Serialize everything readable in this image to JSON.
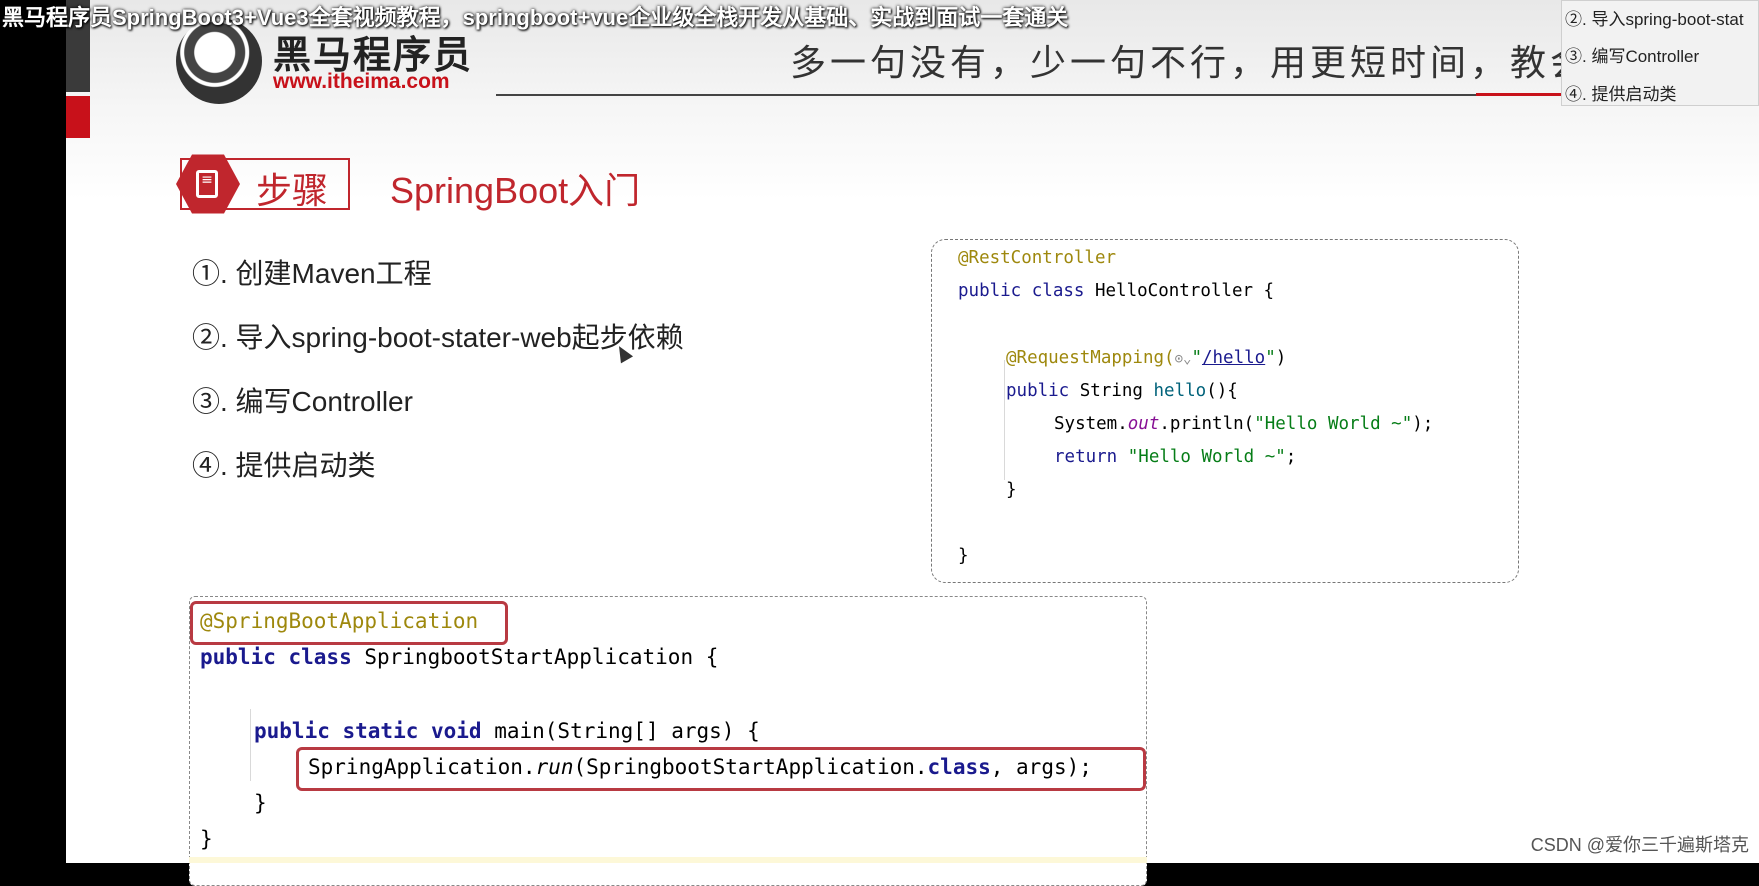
{
  "video": {
    "title": "黑马程序员SpringBoot3+Vue3全套视频教程，springboot+vue企业级全栈开发从基础、实战到面试一套通关"
  },
  "header": {
    "brand": "黑马程序员",
    "url": "www.itheima.com",
    "slogan": "多一句没有，少一句不行，用更短时间，教会更实"
  },
  "section": {
    "badge": "步骤",
    "title": "SpringBoot入门"
  },
  "steps": [
    "①. 创建Maven工程",
    "②. 导入spring-boot-stater-web起步依赖",
    "③. 编写Controller",
    "④. 提供启动类"
  ],
  "popup": {
    "items": [
      "②. 导入spring-boot-stat",
      "③. 编写Controller",
      "④. 提供启动类"
    ]
  },
  "controller_code": {
    "l1": "@RestController",
    "l2_kw": "public class",
    "l2_rest": " HelloController {",
    "l3_ann": "@RequestMapping(",
    "l3_icon": "⊙⌄",
    "l3_q1": "\"",
    "l3_link": "/hello",
    "l3_q2": "\"",
    "l3_close": ")",
    "l4_kw": "public",
    "l4_type": " String ",
    "l4_mtd": "hello",
    "l4_rest": "(){",
    "l5_a": "System.",
    "l5_field": "out",
    "l5_b": ".println(",
    "l5_str": "\"Hello World ~\"",
    "l5_c": ");",
    "l6_kw": "return",
    "l6_str": " \"Hello World ~\"",
    "l6_c": ";",
    "l7": "}",
    "l8": "}"
  },
  "app_code": {
    "l1": "@SpringBootApplication",
    "l2_kw": "public class",
    "l2_rest": " SpringbootStartApplication {",
    "l3_kw": "public static void",
    "l3_rest": " main(String[] args) {",
    "l4_a": "SpringApplication.",
    "l4_run": "run",
    "l4_b": "(SpringbootStartApplication.",
    "l4_kw": "class",
    "l4_c": ", args);",
    "l5": "}",
    "l6": "}"
  },
  "watermark": "CSDN @爱你三千遍斯塔克"
}
